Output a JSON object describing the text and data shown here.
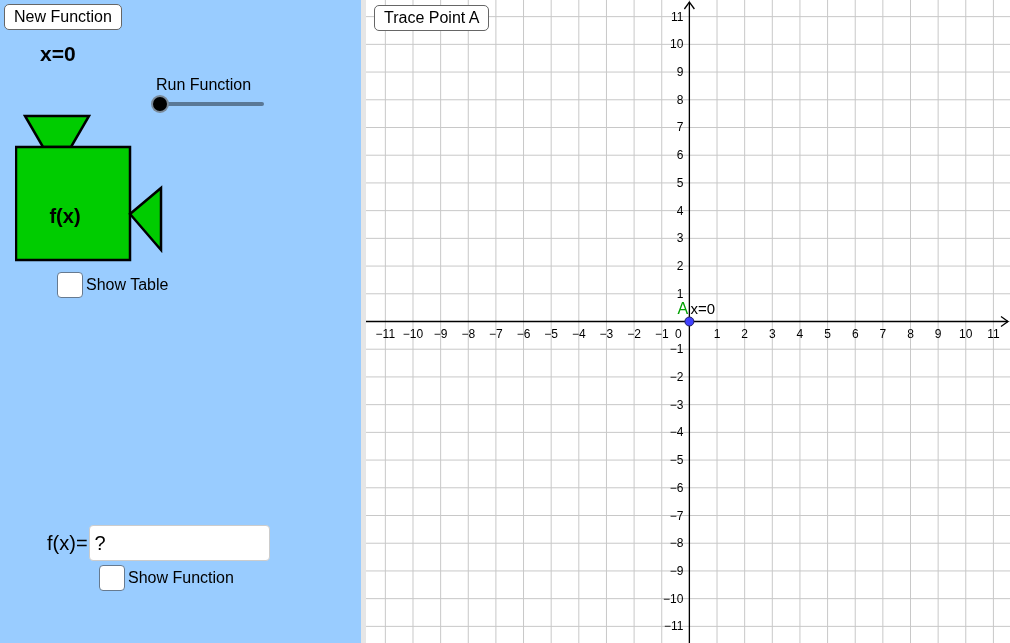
{
  "controls": {
    "new_function_button": "New Function",
    "x_value": "x=0"
  },
  "slider": {
    "label": "Run Function",
    "level": 0
  },
  "machine": {
    "label": "f(x)"
  },
  "show_table": {
    "label": "Show Table",
    "checked": false
  },
  "function_input": {
    "label": "f(x)=",
    "value": "?"
  },
  "show_function": {
    "label": "Show Function",
    "checked": false
  },
  "graph": {
    "trace_button": "Trace Point A",
    "point": {
      "caption": "x=0"
    },
    "origin_label": "0",
    "chart_data": {
      "type": "scatter",
      "xlim": [
        -11.7,
        11.6
      ],
      "ylim": [
        -11.6,
        11.6
      ],
      "grid": true,
      "x": [
        0
      ],
      "series": [
        {
          "name": "A",
          "color": "#4040ff",
          "values": [
            0
          ]
        }
      ],
      "xticks": [
        {
          "value": -11,
          "label": "−11"
        },
        {
          "value": -10,
          "label": "−10"
        },
        {
          "value": -9,
          "label": "−9"
        },
        {
          "value": -8,
          "label": "−8"
        },
        {
          "value": -7,
          "label": "−7"
        },
        {
          "value": -6,
          "label": "−6"
        },
        {
          "value": -5,
          "label": "−5"
        },
        {
          "value": -4,
          "label": "−4"
        },
        {
          "value": -3,
          "label": "−3"
        },
        {
          "value": -2,
          "label": "−2"
        },
        {
          "value": -1,
          "label": "−1"
        },
        1,
        2,
        3,
        4,
        5,
        6,
        7,
        8,
        9,
        10,
        11
      ],
      "yticks": [
        {
          "value": -11,
          "label": "−11"
        },
        {
          "value": -10,
          "label": "−10"
        },
        {
          "value": -9,
          "label": "−9"
        },
        {
          "value": -8,
          "label": "−8"
        },
        {
          "value": -7,
          "label": "−7"
        },
        {
          "value": -6,
          "label": "−6"
        },
        {
          "value": -5,
          "label": "−5"
        },
        {
          "value": -4,
          "label": "−4"
        },
        {
          "value": -3,
          "label": "−3"
        },
        {
          "value": -2,
          "label": "−2"
        },
        {
          "value": -1,
          "label": "−1"
        },
        1,
        2,
        3,
        4,
        5,
        6,
        7,
        8,
        9,
        10,
        11
      ]
    }
  }
}
